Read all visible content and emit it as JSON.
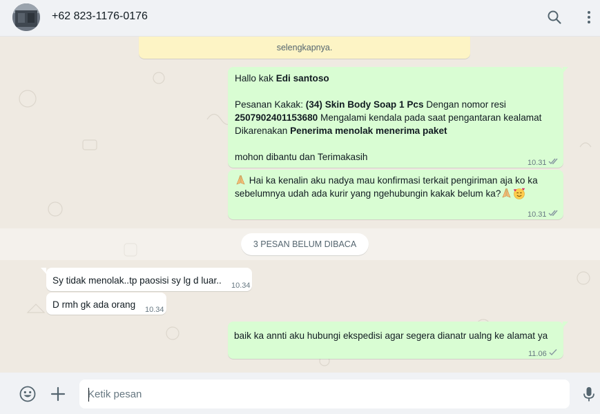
{
  "header": {
    "contact": "+62 823-1176-0176",
    "search_icon": "search-icon",
    "menu_icon": "kebab-menu-icon"
  },
  "system_notice": {
    "text": "selengkapnya."
  },
  "messages": {
    "m1": {
      "greeting": "Hallo kak ",
      "name": "Edi santoso",
      "l2_a": "Pesanan Kakak: ",
      "l2_b": "(34) Skin Body Soap 1 Pcs",
      "l2_c": " Dengan nomor resi",
      "l3_a": "2507902401153680",
      "l3_b": " Mengalami kendala pada saat pengantaran kealamat",
      "l4_a": "Dikarenakan ",
      "l4_b": "Penerima menolak menerima paket",
      "l5": " mohon dibantu dan Terimakasih",
      "time": "10.31"
    },
    "m2": {
      "l1": "Hai ka kenalin aku nadya mau konfirmasi terkait pengiriman aja ko ka",
      "l2": "sebelumnya udah ada kurir yang ngehubungin kakak belum ka?",
      "time": "10.31"
    },
    "unread": "3 PESAN BELUM DIBACA",
    "m3": {
      "text": "Sy tidak menolak..tp paosisi sy lg d luar..",
      "time": "10.34"
    },
    "m4": {
      "text": "D rmh gk ada orang",
      "time": "10.34"
    },
    "m5": {
      "text": "baik ka annti aku hubungi ekspedisi agar segera dianatr ualng ke alamat ya",
      "time": "11.06"
    }
  },
  "footer": {
    "placeholder": "Ketik pesan",
    "emoji_icon": "emoji-icon",
    "attach_icon": "plus-icon",
    "mic_icon": "microphone-icon"
  },
  "colors": {
    "outgoing_bubble": "#d9fdd3",
    "incoming_bubble": "#ffffff",
    "read_ticks": "#53bdeb",
    "chat_bg": "#efeae2",
    "notice_bg": "#fdf4c5"
  }
}
